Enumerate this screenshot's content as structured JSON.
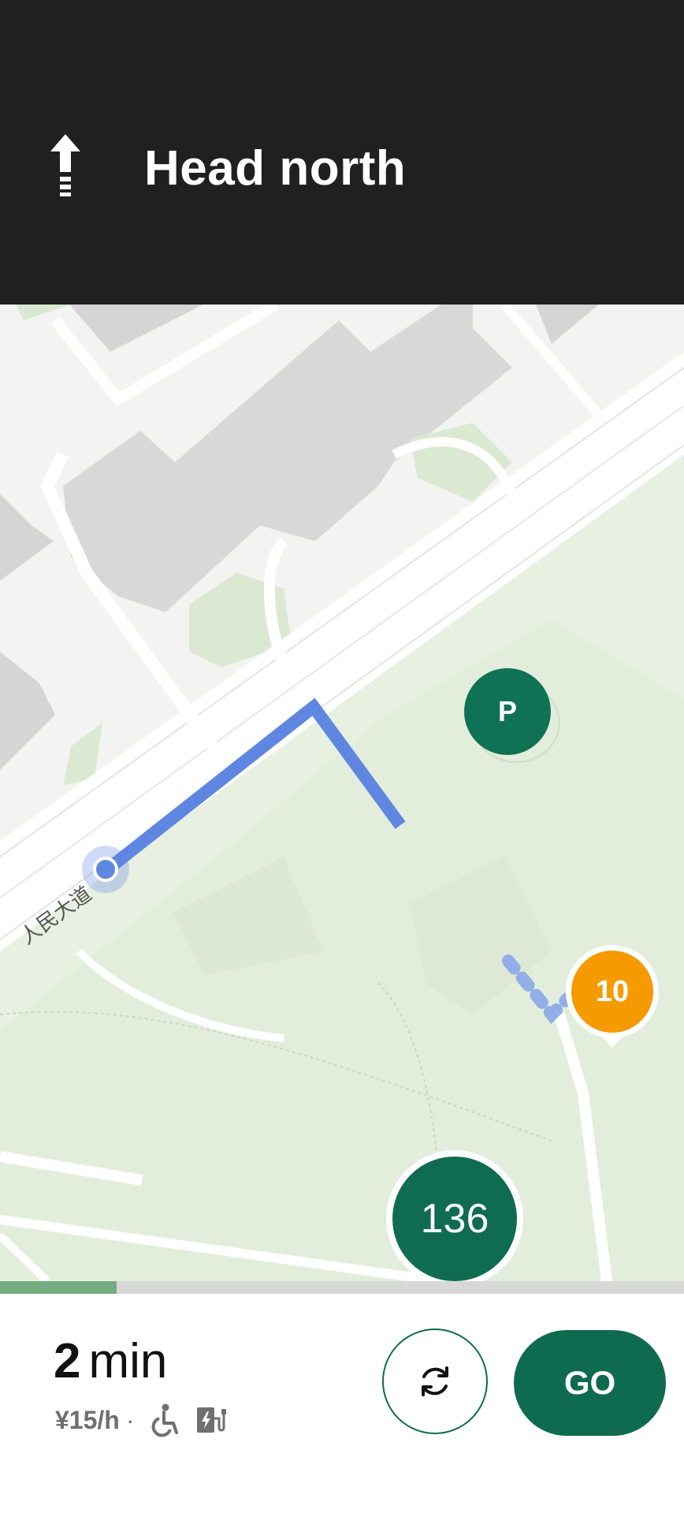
{
  "header": {
    "instruction": "Head north",
    "direction_icon": "arrow-up-icon"
  },
  "map": {
    "road_label": "人民大道",
    "markers": {
      "parking": "P",
      "orange_spot": "10",
      "destination": "136"
    }
  },
  "progress": {
    "fraction": 0.17
  },
  "bottom": {
    "eta_number": "2",
    "eta_unit": "min",
    "price": "¥15/h",
    "separator": "·",
    "icons": [
      "wheelchair-accessible-icon",
      "ev-charging-icon"
    ],
    "go_label": "GO"
  },
  "colors": {
    "brand_green": "#0f6b4f",
    "route_blue": "#5f86e0",
    "orange": "#f59a00",
    "header_bg": "#202020"
  }
}
